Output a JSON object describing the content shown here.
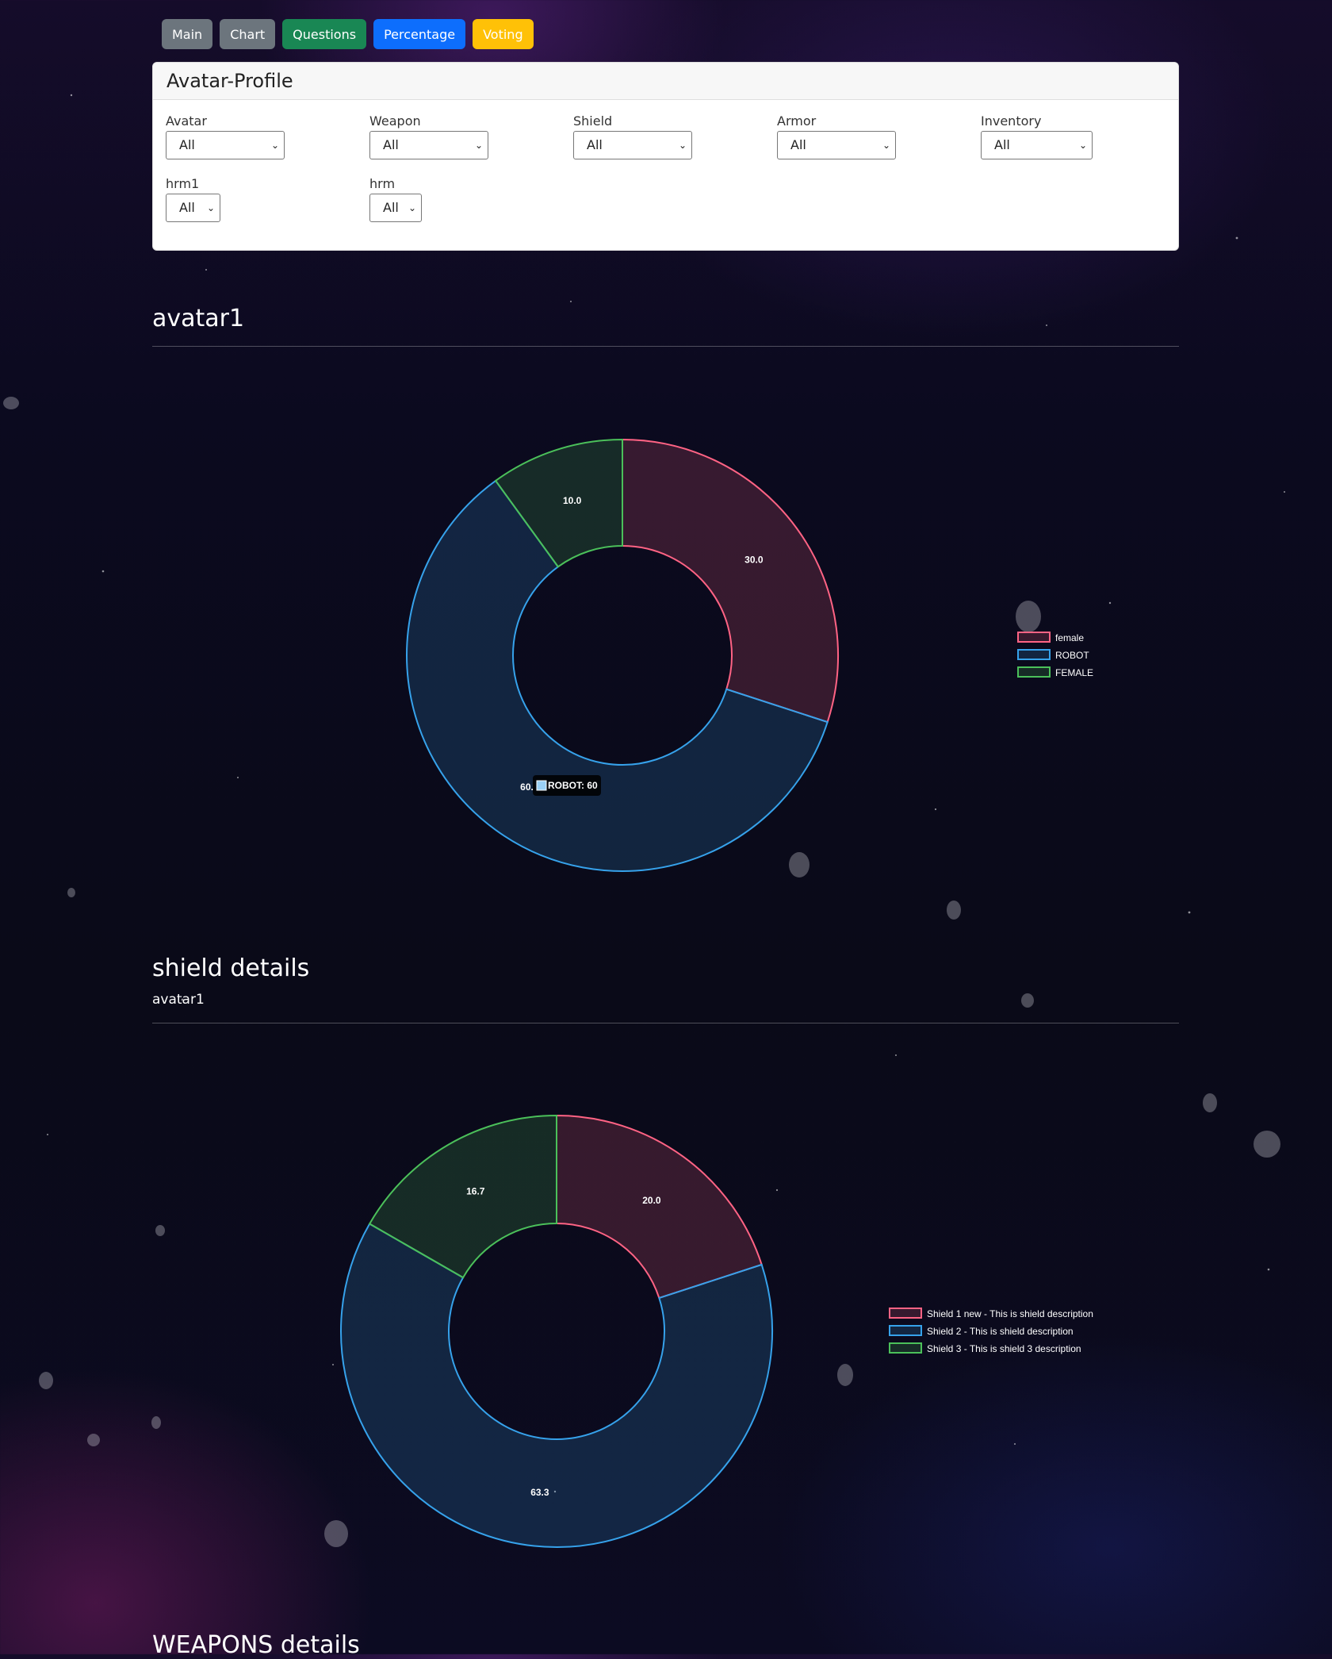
{
  "nav": {
    "buttons": [
      "Main",
      "Chart",
      "Questions",
      "Percentage",
      "Voting"
    ]
  },
  "profile": {
    "title": "Avatar-Profile",
    "filters": [
      {
        "label": "Avatar",
        "value": "All"
      },
      {
        "label": "Weapon",
        "value": "All"
      },
      {
        "label": "Shield",
        "value": "All"
      },
      {
        "label": "Armor",
        "value": "All"
      },
      {
        "label": "Inventory",
        "value": "All"
      },
      {
        "label": "hrm1",
        "value": "All"
      },
      {
        "label": "hrm",
        "value": "All"
      }
    ]
  },
  "sections": {
    "avatar": {
      "title": "avatar1"
    },
    "shield": {
      "title": "shield details",
      "subtitle": "avatar1"
    },
    "weapons": {
      "title": "WEAPONS details"
    }
  },
  "chart_data": [
    {
      "type": "pie",
      "variant": "doughnut",
      "labels": [
        "female",
        "ROBOT",
        "FEMALE"
      ],
      "values": [
        30.0,
        60.0,
        10.0
      ],
      "value_labels": [
        "30.0",
        "60.",
        "10.0"
      ],
      "colors": [
        "#ff6384",
        "#36a2eb",
        "#4bc05a"
      ],
      "legend": "right",
      "tooltip": "ROBOT: 60"
    },
    {
      "type": "pie",
      "variant": "doughnut",
      "labels": [
        "Shield 1 new - This is shield description",
        "Shield 2 - This is shield description",
        "Shield 3 - This is shield 3 description"
      ],
      "values": [
        20.0,
        63.3,
        16.7
      ],
      "value_labels": [
        "20.0",
        "63.3",
        "16.7"
      ],
      "colors": [
        "#ff6384",
        "#36a2eb",
        "#4bc05a"
      ],
      "legend": "right"
    }
  ]
}
